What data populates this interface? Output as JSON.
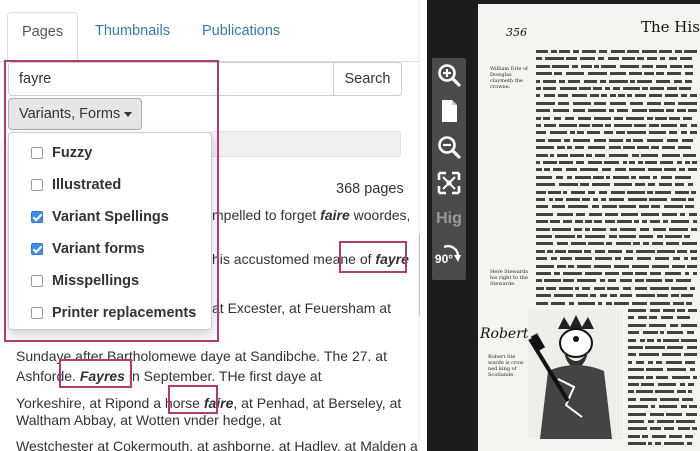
{
  "tabs": [
    {
      "label": "Pages",
      "active": true
    },
    {
      "label": "Thumbnails",
      "active": false
    },
    {
      "label": "Publications",
      "active": false
    }
  ],
  "search": {
    "value": "fayre",
    "button_label": "Search"
  },
  "variants_button": {
    "label": "Variants, Forms"
  },
  "dropdown": {
    "items": [
      {
        "label": "Fuzzy",
        "checked": false
      },
      {
        "label": "Illustrated",
        "checked": false
      },
      {
        "label": "Variant Spellings",
        "checked": true
      },
      {
        "label": "Variant forms",
        "checked": true
      },
      {
        "label": "Misspellings",
        "checked": false
      },
      {
        "label": "Printer replacements",
        "checked": false
      }
    ]
  },
  "results": {
    "count_label": "368 pages",
    "peek_1_pre": "mpelled to forget ",
    "peek_1_em": "faire",
    "peek_1_post": " woordes,",
    "peek_2_pre": "his accustomed meane of ",
    "peek_2_em": "fayre",
    "peek_3": "at Excester, at Feuersham at",
    "line_a": "Sundaye after Bartholomewe daye at Sandibche. The 27. at",
    "line_b_pre": "Ashforde. ",
    "line_b_em": "Fayres",
    "line_b_post": " in September. THe first daye at",
    "line_c_pre": "Yorkeshire, at Ripond a horse ",
    "line_c_em": "faire",
    "line_c_post": ", at Penhad, at Berseley, at",
    "line_d": "Waltham Abbay, at Wotten vnder hedge, at",
    "line_e": "Westchester at Cokermouth, at ashborne, at Hadley, at Malden at"
  },
  "viewer": {
    "tools": [
      "zoom-in-icon",
      "page-icon",
      "zoom-out-icon",
      "fullscreen-icon",
      "highlight-toggle",
      "rotate-icon"
    ],
    "highlight_label": "Hig",
    "rotate_label": "90°",
    "page_number": "356",
    "page_heading": "The Hist",
    "margin_note_1": "William Erle of Dowglas claymeth the crowne.",
    "margin_note_2": "Here Stewards his right to the Stewarde.",
    "margin_note_3": "Robert Ste warde is crow ned king of Scotlande.",
    "robert_label": "Robert."
  },
  "colors": {
    "highlight_border": "#b23a6e",
    "link": "#337ab7",
    "checkbox_checked": "#3d8ee6"
  }
}
